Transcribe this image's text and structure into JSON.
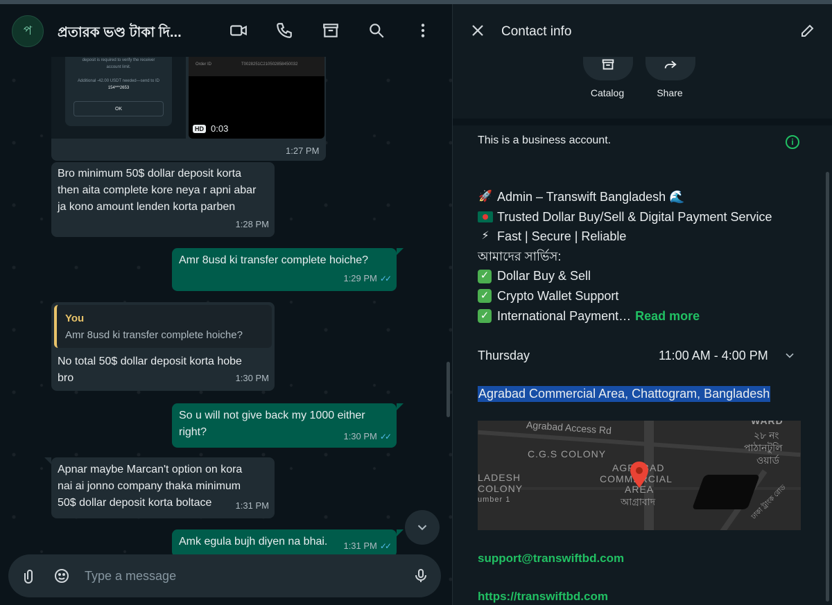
{
  "chat": {
    "title": "প্রতারক ভণ্ড টাকা দি...",
    "avatar_initial": "প",
    "header_icons": [
      "video-call-icon",
      "voice-call-icon",
      "catalog-icon",
      "search-icon",
      "menu-icon"
    ],
    "media": {
      "dialog_line1": "deposit is required to verify the receiver",
      "dialog_line2": "account limit.",
      "dialog_line3": "Additional -42.00 USDT needed—send to ID",
      "dialog_line4": "154***2653",
      "ok_label": "OK",
      "order_label": "Order ID",
      "order_id": "T0028251C210502858450032",
      "hd_badge": "HD",
      "video_duration": "0:03",
      "time": "1:27 PM"
    },
    "messages": [
      {
        "dir": "in",
        "lines": [
          "Bro minimum 50$ dollar deposit korta",
          "then aita complete kore neya r apni abar",
          "ja kono amount lenden korta parben"
        ],
        "time": "1:28 PM"
      },
      {
        "dir": "out",
        "lines": [
          "Amr 8usd ki transfer complete hoiche?"
        ],
        "time": "1:29 PM"
      },
      {
        "dir": "in",
        "reply": {
          "author": "You",
          "text": "Amr 8usd ki transfer complete hoiche?"
        },
        "lines": [
          "No total 50$ dollar deposit korta hobe",
          "bro"
        ],
        "time": "1:30 PM"
      },
      {
        "dir": "out",
        "lines": [
          "So u will not give back my 1000 either",
          "right?"
        ],
        "time": "1:30 PM"
      },
      {
        "dir": "in",
        "lines": [
          "Apnar maybe Marcan't option on kora",
          "nai ai jonno company thaka minimum",
          "50$ dollar deposit korta boltace"
        ],
        "time": "1:31 PM"
      },
      {
        "dir": "out",
        "lines": [
          "Amk egula bujh diyen na bhai."
        ],
        "time": "1:31 PM"
      }
    ],
    "read_ticks": "✓✓",
    "composer": {
      "placeholder": "Type a message"
    }
  },
  "info": {
    "title": "Contact info",
    "actions": [
      {
        "label": "Catalog",
        "icon": "catalog-icon"
      },
      {
        "label": "Share",
        "icon": "share-icon"
      }
    ],
    "business_note": "This is a business account.",
    "about": [
      {
        "icon": "🚀",
        "text": "Admin – Transwift Bangladesh 🌊"
      },
      {
        "icon": "bangladesh-flag",
        "text": "Trusted Dollar Buy/Sell & Digital Payment Service"
      },
      {
        "icon": "⚡",
        "text": "Fast | Secure | Reliable"
      },
      {
        "icon": "",
        "text": "আমাদের সার্ভিস:"
      },
      {
        "icon": "check",
        "text": "Dollar Buy & Sell"
      },
      {
        "icon": "check",
        "text": "Crypto Wallet Support"
      },
      {
        "icon": "check",
        "text": "International Payment…"
      }
    ],
    "read_more": "Read more",
    "check_glyph": "✓",
    "hours": {
      "day": "Thursday",
      "time": "11:00 AM - 4:00 PM"
    },
    "address": "Agrabad Commercial Area, Chattogram, Bangladesh",
    "map_labels": {
      "road": "Agrabad Access Rd",
      "colony": "C.G.S COLONY",
      "ward": "WARD",
      "ward_bn1": "২৮ নং",
      "ward_bn2": "পাঠানটুলি",
      "ward_bn3": "ওয়ার্ড",
      "area1": "AGRABAD",
      "area2": "COMMERCIAL",
      "area3": "AREA",
      "area_bn": "আগ্রাবাদ",
      "left1": "LADESH",
      "left2": "COLONY",
      "left3": "umber 1",
      "diag": "ঢাকা ট্রাংক রোড"
    },
    "email": "support@transwiftbd.com",
    "website": "https://transwiftbd.com",
    "accent": "#21c063"
  }
}
